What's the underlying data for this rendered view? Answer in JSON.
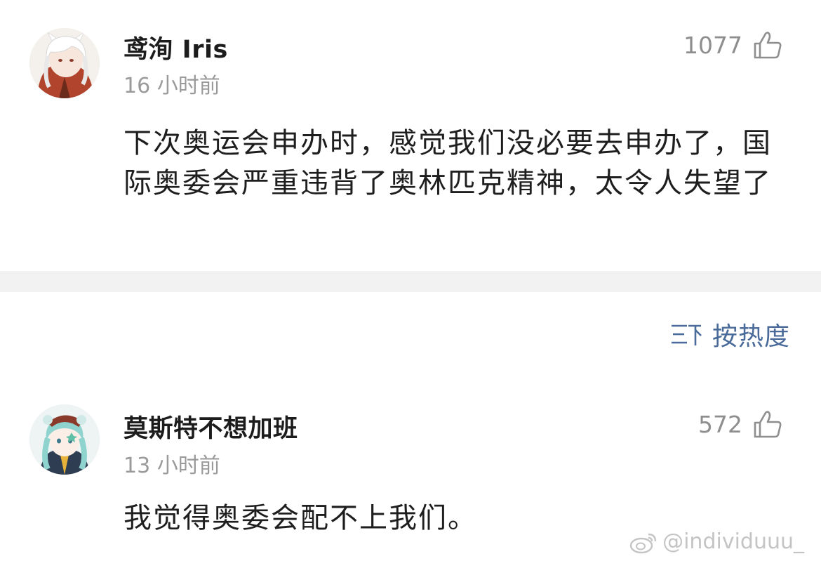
{
  "comments": [
    {
      "username": "鸢洵 Iris",
      "time": "16 小时前",
      "likes": "1077",
      "content": "下次奥运会申办时，感觉我们没必要去申办了，国际奥委会严重违背了奥林匹克精神，太令人失望了",
      "avatar_icon": "avatar-white-hair-icon"
    },
    {
      "username": "莫斯特不想加班",
      "time": "13 小时前",
      "likes": "572",
      "content": "我觉得奥委会配不上我们。",
      "avatar_icon": "avatar-teal-hair-icon"
    }
  ],
  "sort": {
    "label": "按热度",
    "icon": "sort-icon"
  },
  "watermark": {
    "text": "@individuuu_",
    "icon": "weibo-logo-icon"
  },
  "colors": {
    "accent": "#4a6b9a",
    "muted": "#9a9a9a",
    "divider": "#f2f2f2"
  }
}
